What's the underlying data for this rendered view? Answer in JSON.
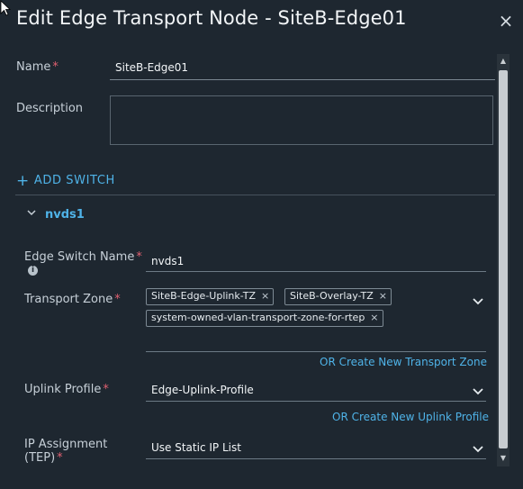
{
  "dialog": {
    "title": "Edit Edge Transport Node - SiteB-Edge01",
    "close_glyph": "×"
  },
  "form": {
    "name_label": "Name",
    "name_required": "*",
    "name_value": "SiteB-Edge01",
    "description_label": "Description",
    "description_value": "",
    "add_switch_label": "ADD SWITCH",
    "add_switch_icon": "plus-icon"
  },
  "switch": {
    "section_title": "nvds1",
    "edge_switch_name_label": "Edge Switch Name",
    "edge_switch_name_required": "*",
    "edge_switch_name_value": "nvds1",
    "transport_zone_label": "Transport Zone",
    "transport_zone_required": "*",
    "transport_zones": [
      "SiteB-Edge-Uplink-TZ",
      "SiteB-Overlay-TZ",
      "system-owned-vlan-transport-zone-for-rtep"
    ],
    "chip_remove_glyph": "×",
    "create_transport_zone_link": "OR Create New Transport Zone",
    "uplink_profile_label": "Uplink Profile",
    "uplink_profile_required": "*",
    "uplink_profile_value": "Edge-Uplink-Profile",
    "create_uplink_profile_link": "OR Create New Uplink Profile",
    "ip_assignment_label_line1": "IP Assignment",
    "ip_assignment_label_line2": "(TEP)",
    "ip_assignment_required": "*",
    "ip_assignment_value": "Use Static IP List"
  },
  "colors": {
    "background": "#1e2730",
    "accent": "#4fb3e8",
    "required": "#e06070",
    "text": "#f2f5f7"
  }
}
